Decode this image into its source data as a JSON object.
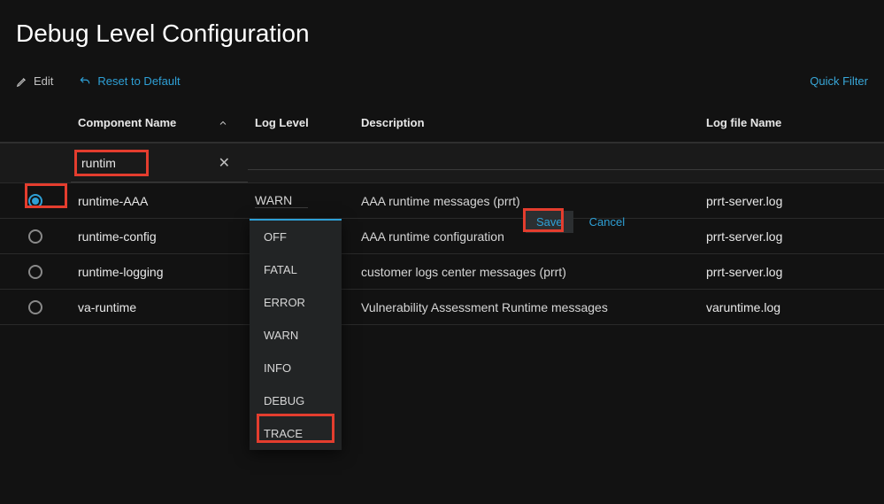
{
  "title": "Debug Level Configuration",
  "toolbar": {
    "edit_label": "Edit",
    "reset_label": "Reset to Default",
    "quick_filter_label": "Quick Filter"
  },
  "columns": {
    "component": "Component Name",
    "loglevel": "Log Level",
    "description": "Description",
    "logfile": "Log file Name"
  },
  "filter": {
    "component_value": "runtim"
  },
  "rows": [
    {
      "selected": true,
      "component": "runtime-AAA",
      "loglevel": "WARN",
      "description": "AAA runtime messages (prrt)",
      "logfile": "prrt-server.log"
    },
    {
      "selected": false,
      "component": "runtime-config",
      "loglevel": "",
      "description": "AAA runtime configuration",
      "logfile": "prrt-server.log"
    },
    {
      "selected": false,
      "component": "runtime-logging",
      "loglevel": "",
      "description": "customer logs center messages (prrt)",
      "logfile": "prrt-server.log"
    },
    {
      "selected": false,
      "component": "va-runtime",
      "loglevel": "",
      "description": "Vulnerability Assessment Runtime messages",
      "logfile": "varuntime.log"
    }
  ],
  "dropdown": {
    "options": [
      "OFF",
      "FATAL",
      "ERROR",
      "WARN",
      "INFO",
      "DEBUG",
      "TRACE"
    ]
  },
  "actions": {
    "save_label": "Save",
    "cancel_label": "Cancel"
  }
}
